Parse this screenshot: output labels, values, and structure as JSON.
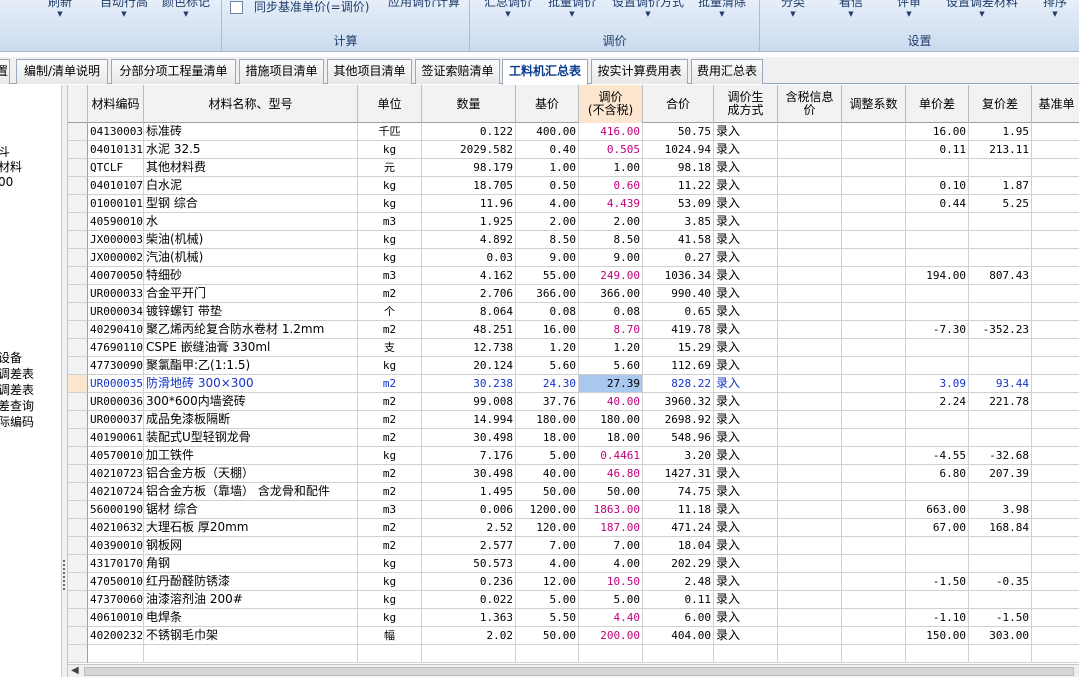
{
  "ribbon": {
    "buttons": [
      {
        "name": "refresh-button",
        "label": "刷新"
      },
      {
        "name": "auto-row-button",
        "label": "自动行高"
      },
      {
        "name": "color-mark-button",
        "label": "颜色标记"
      },
      {
        "name": "apply-adjust-button",
        "label": "应用调价计算"
      },
      {
        "name": "summary-adjust-button",
        "label": "汇总调价"
      },
      {
        "name": "batch-adjust-button",
        "label": "批量调价"
      },
      {
        "name": "set-adjust-method-button",
        "label": "设置调价方式"
      },
      {
        "name": "batch-clear-button",
        "label": "批量清除"
      },
      {
        "name": "classify-button",
        "label": "分类"
      },
      {
        "name": "note-button",
        "label": "看信"
      },
      {
        "name": "review-button",
        "label": "评审"
      },
      {
        "name": "set-diff-material-button",
        "label": "设置调差材料"
      },
      {
        "name": "sort-button",
        "label": "排序"
      }
    ],
    "sync_checkbox_label": "同步基准单价(=调价)",
    "groups": {
      "calc": "计算",
      "adjust": "调价",
      "settings": "设置"
    }
  },
  "tabs": [
    {
      "label": "置"
    },
    {
      "label": "编制/清单说明"
    },
    {
      "label": "分部分项工程量清单"
    },
    {
      "label": "措施项目清单"
    },
    {
      "label": "其他项目清单"
    },
    {
      "label": "签证索赔清单"
    },
    {
      "label": "工料机汇总表",
      "active": true
    },
    {
      "label": "按实计算费用表"
    },
    {
      "label": "费用汇总表"
    }
  ],
  "left_panel": [
    "斗",
    "材料",
    "00",
    "设备",
    "调差表",
    "调差表",
    "差查询",
    "际编码"
  ],
  "columns": [
    "材料编码",
    "材料名称、型号",
    "单位",
    "数量",
    "基价",
    "调价\n(不含税)",
    "合价",
    "调价生\n成方式",
    "含税信息\n价",
    "调整系数",
    "单价差",
    "复价差",
    "基准单"
  ],
  "rows": [
    [
      "04130003",
      "标准砖",
      "千匹",
      "0.122",
      "400.00",
      "416.00",
      "50.75",
      "录入",
      "",
      "",
      "16.00",
      "1.95",
      ""
    ],
    [
      "04010131",
      "水泥 32.5",
      "kg",
      "2029.582",
      "0.40",
      "0.505",
      "1024.94",
      "录入",
      "",
      "",
      "0.11",
      "213.11",
      ""
    ],
    [
      "QTCLF",
      "其他材料费",
      "元",
      "98.179",
      "1.00",
      "1.00",
      "98.18",
      "录入",
      "",
      "",
      "",
      "",
      ""
    ],
    [
      "04010107",
      "白水泥",
      "kg",
      "18.705",
      "0.50",
      "0.60",
      "11.22",
      "录入",
      "",
      "",
      "0.10",
      "1.87",
      ""
    ],
    [
      "01000101",
      "型钢 综合",
      "kg",
      "11.96",
      "4.00",
      "4.439",
      "53.09",
      "录入",
      "",
      "",
      "0.44",
      "5.25",
      ""
    ],
    [
      "40590010",
      "水",
      "m3",
      "1.925",
      "2.00",
      "2.00",
      "3.85",
      "录入",
      "",
      "",
      "",
      "",
      ""
    ],
    [
      "JX000003",
      "柴油(机械)",
      "kg",
      "4.892",
      "8.50",
      "8.50",
      "41.58",
      "录入",
      "",
      "",
      "",
      "",
      ""
    ],
    [
      "JX000002",
      "汽油(机械)",
      "kg",
      "0.03",
      "9.00",
      "9.00",
      "0.27",
      "录入",
      "",
      "",
      "",
      "",
      ""
    ],
    [
      "40070050",
      "特细砂",
      "m3",
      "4.162",
      "55.00",
      "249.00",
      "1036.34",
      "录入",
      "",
      "",
      "194.00",
      "807.43",
      ""
    ],
    [
      "UR000033",
      "合金平开门",
      "m2",
      "2.706",
      "366.00",
      "366.00",
      "990.40",
      "录入",
      "",
      "",
      "",
      "",
      ""
    ],
    [
      "UR000034",
      "镀锌螺钉 带垫",
      "个",
      "8.064",
      "0.08",
      "0.08",
      "0.65",
      "录入",
      "",
      "",
      "",
      "",
      ""
    ],
    [
      "40290410",
      "聚乙烯丙纶复合防水卷材 1.2mm",
      "m2",
      "48.251",
      "16.00",
      "8.70",
      "419.78",
      "录入",
      "",
      "",
      "-7.30",
      "-352.23",
      ""
    ],
    [
      "47690110",
      "CSPE 嵌缝油膏 330ml",
      "支",
      "12.738",
      "1.20",
      "1.20",
      "15.29",
      "录入",
      "",
      "",
      "",
      "",
      ""
    ],
    [
      "47730090",
      "聚氯酯甲:乙(1:1.5)",
      "kg",
      "20.124",
      "5.60",
      "5.60",
      "112.69",
      "录入",
      "",
      "",
      "",
      "",
      ""
    ],
    [
      "UR000035",
      "防滑地砖 300×300",
      "m2",
      "30.238",
      "24.30",
      "27.39",
      "828.22",
      "录入",
      "",
      "",
      "3.09",
      "93.44",
      ""
    ],
    [
      "UR000036",
      "300*600内墙瓷砖",
      "m2",
      "99.008",
      "37.76",
      "40.00",
      "3960.32",
      "录入",
      "",
      "",
      "2.24",
      "221.78",
      ""
    ],
    [
      "UR000037",
      "成品免漆板隔断",
      "m2",
      "14.994",
      "180.00",
      "180.00",
      "2698.92",
      "录入",
      "",
      "",
      "",
      "",
      ""
    ],
    [
      "40190061",
      "装配式U型轻钢龙骨",
      "m2",
      "30.498",
      "18.00",
      "18.00",
      "548.96",
      "录入",
      "",
      "",
      "",
      "",
      ""
    ],
    [
      "40570010",
      "加工铁件",
      "kg",
      "7.176",
      "5.00",
      "0.4461",
      "3.20",
      "录入",
      "",
      "",
      "-4.55",
      "-32.68",
      ""
    ],
    [
      "40210723",
      "铝合金方板（天棚）",
      "m2",
      "30.498",
      "40.00",
      "46.80",
      "1427.31",
      "录入",
      "",
      "",
      "6.80",
      "207.39",
      ""
    ],
    [
      "40210724",
      "铝合金方板（靠墙） 含龙骨和配件",
      "m2",
      "1.495",
      "50.00",
      "50.00",
      "74.75",
      "录入",
      "",
      "",
      "",
      "",
      ""
    ],
    [
      "56000190",
      "锯材 综合",
      "m3",
      "0.006",
      "1200.00",
      "1863.00",
      "11.18",
      "录入",
      "",
      "",
      "663.00",
      "3.98",
      ""
    ],
    [
      "40210632",
      "大理石板 厚20mm",
      "m2",
      "2.52",
      "120.00",
      "187.00",
      "471.24",
      "录入",
      "",
      "",
      "67.00",
      "168.84",
      ""
    ],
    [
      "40390010",
      "钢板网",
      "m2",
      "2.577",
      "7.00",
      "7.00",
      "18.04",
      "录入",
      "",
      "",
      "",
      "",
      ""
    ],
    [
      "43170170",
      "角钢",
      "kg",
      "50.573",
      "4.00",
      "4.00",
      "202.29",
      "录入",
      "",
      "",
      "",
      "",
      ""
    ],
    [
      "47050010",
      "红丹酚醛防锈漆",
      "kg",
      "0.236",
      "12.00",
      "10.50",
      "2.48",
      "录入",
      "",
      "",
      "-1.50",
      "-0.35",
      ""
    ],
    [
      "47370060",
      "油漆溶剂油 200#",
      "kg",
      "0.022",
      "5.00",
      "5.00",
      "0.11",
      "录入",
      "",
      "",
      "",
      "",
      ""
    ],
    [
      "40610010",
      "电焊条",
      "kg",
      "1.363",
      "5.50",
      "4.40",
      "6.00",
      "录入",
      "",
      "",
      "-1.10",
      "-1.50",
      ""
    ],
    [
      "40200232",
      "不锈钢毛巾架",
      "幅",
      "2.02",
      "50.00",
      "200.00",
      "404.00",
      "录入",
      "",
      "",
      "150.00",
      "303.00",
      ""
    ],
    [
      "",
      "",
      "",
      "",
      "",
      "",
      "",
      "",
      "",
      "",
      "",
      "",
      ""
    ]
  ],
  "selected_row": 14,
  "colors": {
    "accent": "#1f3d6b",
    "changed_price": "#c0007a",
    "selected_text": "#1432c8",
    "selected_cell": "#a8c8f0",
    "header_highlight": "#fde6d0"
  }
}
